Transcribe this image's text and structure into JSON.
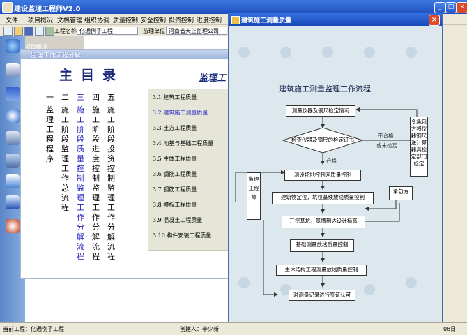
{
  "main_window": {
    "title": "建设监理工程师V2.0"
  },
  "menu": [
    "文件",
    "项目概况",
    "文档管理",
    "组织协调",
    "质量控制",
    "安全控制",
    "投资控制",
    "进度控制"
  ],
  "toolbar": {
    "project_label": "工程名称",
    "project_value": "亿通例子工程",
    "unit_label": "监理单位",
    "unit_value": "河南省天正监理公司"
  },
  "left_panel_label": "项目概况",
  "status": {
    "current_project": "当前工程：亿通例子工程",
    "creator": "创建人：李少新",
    "date_tail": "08日"
  },
  "flow_window": {
    "title": "监理工作流程分解",
    "main_catalog": "主目录",
    "sub_heading": "监理工",
    "columns": [
      {
        "num": "一",
        "text": "监理工程程序",
        "selected": false
      },
      {
        "num": "二",
        "text": "施工阶段监理工作总流程",
        "selected": false
      },
      {
        "num": "三",
        "text": "施工阶段质量控制监理工作分解流程",
        "selected": true
      },
      {
        "num": "四",
        "text": "施工阶段进度控制监理工作分解流程",
        "selected": false
      },
      {
        "num": "五",
        "text": "施工阶段投资控制监理工作分解流程",
        "selected": false
      }
    ],
    "items": [
      {
        "label": "3.1 建筑工程质量",
        "selected": false
      },
      {
        "label": "3.2 建筑施工测量质量",
        "selected": true
      },
      {
        "label": "3.3 土方工程质量",
        "selected": false
      },
      {
        "label": "3.4 地基与基础工程质量",
        "selected": false
      },
      {
        "label": "3.5 主体工程质量",
        "selected": false
      },
      {
        "label": "3.6 钢筋工程质量",
        "selected": false
      },
      {
        "label": "3.7 钢筋工程质量",
        "selected": false
      },
      {
        "label": "3.8 模板工程质量",
        "selected": false
      },
      {
        "label": "3.9 混凝土工程质量",
        "selected": false
      },
      {
        "label": "3.10 构件安装工程质量",
        "selected": false
      }
    ]
  },
  "survey_window": {
    "title": "建筑施工测量质量",
    "flow_title": "建筑施工测量监理工作流程",
    "boxes": {
      "b1": "测量仪器及钢尺检定情况",
      "b2": "检查仪器及钢尺的检定证书",
      "b3": "测设场地控制网质量控制",
      "b4": "建筑物定位，坑位基线放线质量控制",
      "b5": "开挖基坑，基槽到达设计标高",
      "b6": "基础测量放线质量控制",
      "b7": "主体结构工程测量放线质量控制",
      "b8": "对测量记录进行签证认可",
      "supervisor": "监理工程师",
      "contractor": "承包方",
      "right_box": "令承包方将仪器钢尺送计算器具检定部门检定"
    },
    "labels": {
      "fail": "不合格",
      "expired": "或未检定",
      "pass": "合格"
    }
  },
  "colors": {
    "titlebar": "#2a5ccc",
    "selected_text": "#2020c0",
    "heading": "#1a2a7a"
  }
}
